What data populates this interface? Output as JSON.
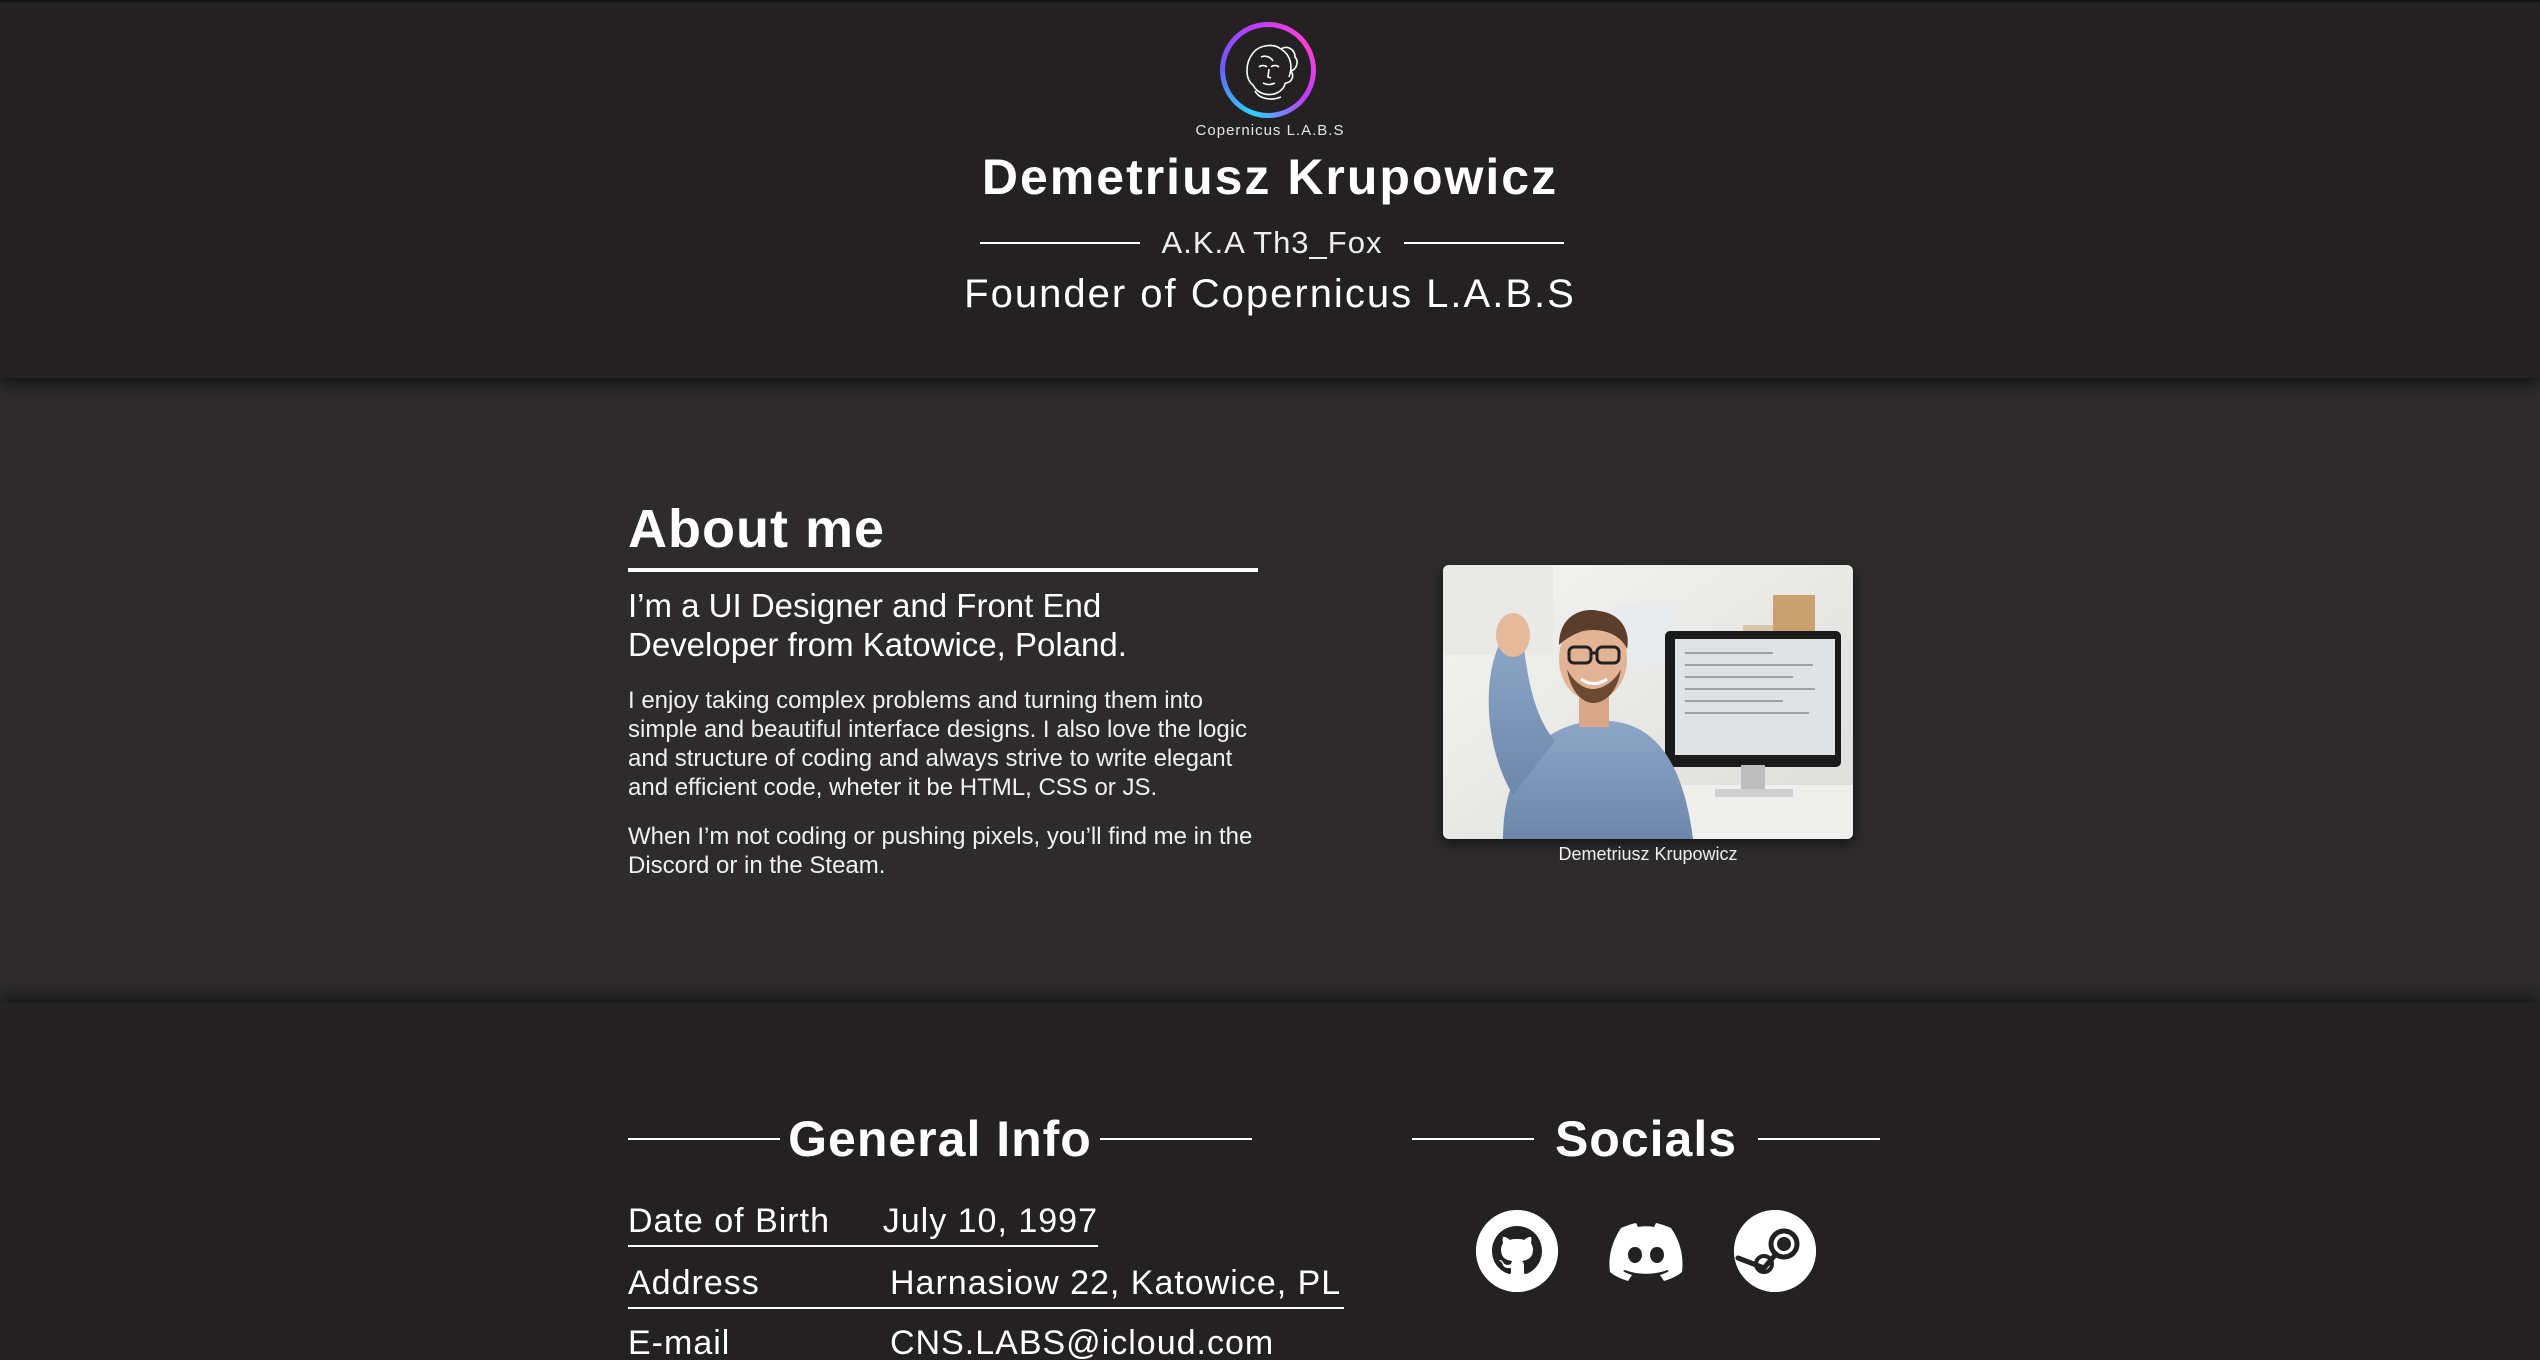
{
  "header": {
    "logo_caption": "Copernicus L.A.B.S",
    "name": "Demetriusz Krupowicz",
    "aka": "A.K.A Th3_Fox",
    "tagline": "Founder of Copernicus L.A.B.S"
  },
  "about": {
    "heading": "About me",
    "lead": "I’m a UI Designer and Front End Developer from Katowice, Poland.",
    "paragraph1": "I enjoy taking complex problems and turning them into simple and beautiful interface designs. I also love the logic and structure of coding and always strive to write elegant and efficient code, wheter it be HTML, CSS or JS.",
    "paragraph2": "When I’m not coding or pushing pixels, you’ll find me in the Discord or in the Steam.",
    "photo_caption": "Demetriusz Krupowicz"
  },
  "general_info": {
    "heading": "General Info",
    "rows": [
      {
        "label": "Date of Birth",
        "value": "July 10, 1997"
      },
      {
        "label": "Address",
        "value": "Harnasiow 22, Katowice, PL"
      },
      {
        "label": "E-mail",
        "value": "CNS.LABS@icloud.com"
      }
    ]
  },
  "socials": {
    "heading": "Socials",
    "items": [
      {
        "icon": "github-icon"
      },
      {
        "icon": "discord-icon"
      },
      {
        "icon": "steam-icon"
      }
    ]
  },
  "colors": {
    "header_bg": "#232122",
    "about_bg": "#2d2b2c",
    "logo_gradient_start": "#2ad4ff",
    "logo_gradient_end": "#ff3fd0",
    "text": "#ffffff"
  }
}
